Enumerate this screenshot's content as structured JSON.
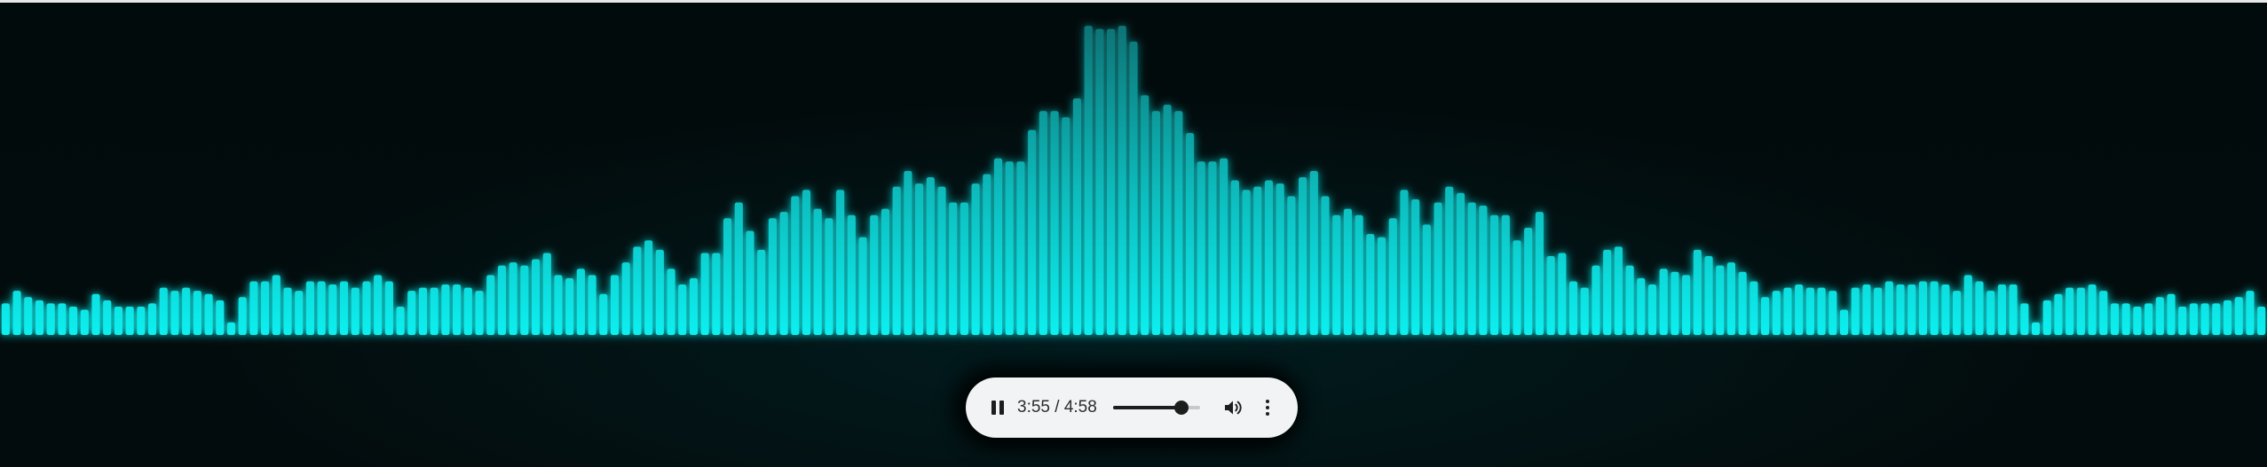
{
  "player": {
    "state": "playing",
    "current_time": "3:55",
    "separator": "/",
    "duration": "4:58",
    "progress": 0.789,
    "icons": {
      "play_pause": "pause-icon",
      "volume": "volume-icon",
      "more": "more-options-icon"
    }
  },
  "visualizer": {
    "levels": [
      0.1,
      0.14,
      0.12,
      0.11,
      0.1,
      0.1,
      0.09,
      0.08,
      0.13,
      0.11,
      0.09,
      0.09,
      0.09,
      0.1,
      0.15,
      0.14,
      0.15,
      0.14,
      0.13,
      0.11,
      0.04,
      0.12,
      0.17,
      0.17,
      0.19,
      0.15,
      0.14,
      0.17,
      0.17,
      0.16,
      0.17,
      0.15,
      0.17,
      0.19,
      0.17,
      0.09,
      0.14,
      0.15,
      0.15,
      0.16,
      0.16,
      0.15,
      0.14,
      0.19,
      0.22,
      0.23,
      0.22,
      0.24,
      0.26,
      0.19,
      0.18,
      0.21,
      0.19,
      0.13,
      0.19,
      0.23,
      0.28,
      0.3,
      0.27,
      0.21,
      0.16,
      0.18,
      0.26,
      0.26,
      0.37,
      0.42,
      0.33,
      0.27,
      0.37,
      0.39,
      0.44,
      0.46,
      0.4,
      0.37,
      0.46,
      0.38,
      0.31,
      0.38,
      0.4,
      0.47,
      0.52,
      0.48,
      0.5,
      0.47,
      0.42,
      0.42,
      0.48,
      0.51,
      0.56,
      0.55,
      0.55,
      0.65,
      0.71,
      0.71,
      0.69,
      0.75,
      0.98,
      0.97,
      0.97,
      0.98,
      0.93,
      0.76,
      0.71,
      0.73,
      0.71,
      0.64,
      0.55,
      0.55,
      0.56,
      0.49,
      0.46,
      0.47,
      0.49,
      0.48,
      0.44,
      0.5,
      0.52,
      0.44,
      0.38,
      0.4,
      0.38,
      0.32,
      0.31,
      0.37,
      0.46,
      0.43,
      0.35,
      0.42,
      0.47,
      0.45,
      0.42,
      0.41,
      0.38,
      0.38,
      0.3,
      0.34,
      0.39,
      0.25,
      0.26,
      0.17,
      0.15,
      0.22,
      0.27,
      0.28,
      0.22,
      0.18,
      0.16,
      0.21,
      0.2,
      0.19,
      0.27,
      0.25,
      0.22,
      0.23,
      0.2,
      0.17,
      0.12,
      0.14,
      0.15,
      0.16,
      0.15,
      0.15,
      0.14,
      0.08,
      0.15,
      0.16,
      0.15,
      0.17,
      0.16,
      0.16,
      0.17,
      0.17,
      0.16,
      0.14,
      0.19,
      0.17,
      0.14,
      0.16,
      0.16,
      0.1,
      0.04,
      0.11,
      0.13,
      0.15,
      0.15,
      0.16,
      0.14,
      0.1,
      0.1,
      0.09,
      0.1,
      0.12,
      0.13,
      0.09,
      0.1,
      0.1,
      0.1,
      0.11,
      0.12,
      0.14,
      0.09
    ]
  },
  "colors": {
    "background": "#030b0c",
    "bar_bottom": "#0ff0f0",
    "bar_top": "#0a7c7e",
    "player_background": "#f1f3f4",
    "player_text": "#2b2b2b",
    "player_controls": "#1d1d1d",
    "progress_track": "#c8c8c8"
  }
}
